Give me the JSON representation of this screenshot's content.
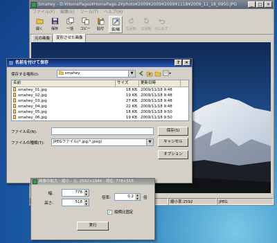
{
  "main_window": {
    "title": "SmaHey - D:¥HomePages¥HomePage-2¥photo¥2009¥2009¥2009¥1118¥2009_11_18_0950.JPG",
    "controls": {
      "minimize": "_",
      "maximize": "□",
      "close": "×"
    },
    "menu": [
      "ファイル(F)",
      "編集(E)",
      "ツール(T)",
      "ヘルプ(H)"
    ],
    "toolbar": [
      {
        "label": "開く",
        "icon": "folder-open-icon",
        "enabled": true
      },
      {
        "label": "保存",
        "icon": "save-disk-icon",
        "enabled": true
      },
      {
        "label": "一括",
        "icon": "batch-icon",
        "enabled": true
      },
      {
        "label": "コピー",
        "icon": "copy-icon",
        "enabled": true
      },
      {
        "label": "貼付",
        "icon": "paste-icon",
        "enabled": true
      },
      {
        "label": "拡/縮",
        "icon": "resize-icon",
        "enabled": true,
        "active": true
      },
      {
        "label": "左回転",
        "icon": "rotate-left-icon",
        "enabled": false
      },
      {
        "label": "右回転",
        "icon": "rotate-right-icon",
        "enabled": false
      },
      {
        "label": "元に戻す",
        "icon": "undo-icon",
        "enabled": false
      }
    ],
    "tabs": [
      "元の画像",
      "変形させた画像"
    ],
    "status": [
      "加工",
      "",
      "",
      "縮小後のサイズ",
      "縮小率:2592",
      "JPEG"
    ]
  },
  "save_dialog": {
    "title": "名前を付けて保存",
    "save_in_label": "保存する場所(I):",
    "save_in_value": "smahey",
    "columns": [
      "名前",
      "サイズ",
      "更新日時"
    ],
    "files": [
      {
        "name": "smahey_01.jpg",
        "size": "18 KB",
        "date": "2009/11/18 9:48"
      },
      {
        "name": "smahey_02.jpg",
        "size": "19 KB",
        "date": "2009/11/18 9:48"
      },
      {
        "name": "smahey_03.jpg",
        "size": "27 KB",
        "date": "2009/11/18 9:48"
      },
      {
        "name": "smahey_04.jpg",
        "size": "22 KB",
        "date": "2009/11/18 9:48"
      },
      {
        "name": "smahey_05.jpg",
        "size": "18 KB",
        "date": "2009/11/18 9:50"
      },
      {
        "name": "smahey_06.jpg",
        "size": "19 KB",
        "date": "2009/11/18 9:50"
      }
    ],
    "filename_label": "ファイル名(N):",
    "filename_value": "",
    "filetype_label": "ファイルの種類(T):",
    "filetype_value": "JPEGファイル(*.jpg;*.jpeg)",
    "save_button": "保存(S)",
    "cancel_button": "キャンセル",
    "options_button": "オプション"
  },
  "resize_dialog": {
    "title": "画像の拡大・縮小 - 元: 2592×1944 - 現在: 778×518",
    "width_label": "幅:",
    "width_value": "778",
    "height_label": "高さ:",
    "height_value": "518",
    "scale_label": "倍率:",
    "scale_value": "0.2",
    "scale_unit": "倍",
    "keep_ratio_label": "縦横比固定",
    "keep_ratio_checked": true,
    "execute_button": "実行"
  }
}
